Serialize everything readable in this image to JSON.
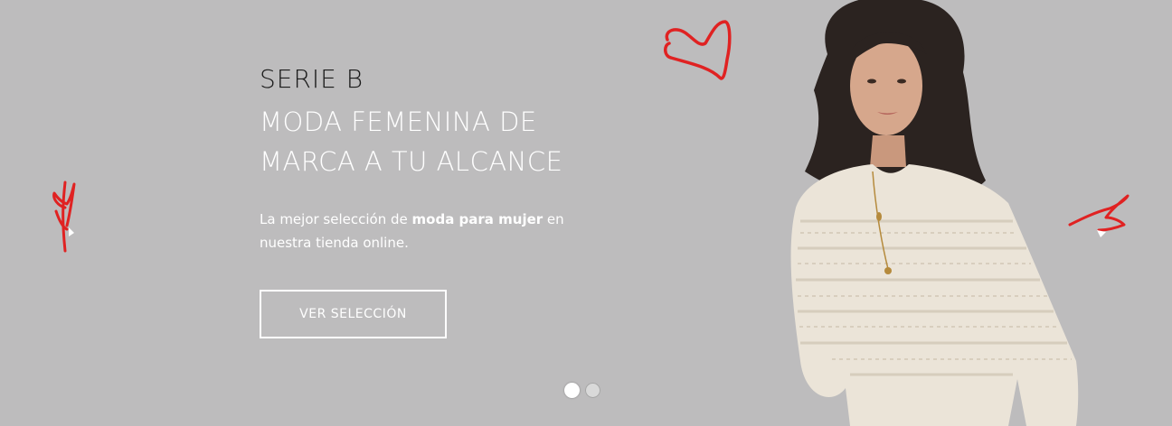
{
  "hero": {
    "brand": "SERIE B",
    "headline_line1": "MODA FEMENINA DE",
    "headline_line2": "MARCA A TU ALCANCE",
    "description_prefix": "La mejor selección de ",
    "description_bold": "moda para mujer",
    "description_suffix": " en nuestra tienda online.",
    "cta_label": "VER SELECCIÓN",
    "background_color": "#bdbcbd",
    "accent_color": "#e02222"
  },
  "carousel": {
    "slide_count": 2,
    "active_slide": 1,
    "prev_icon": "scribble-arrow-left-icon",
    "next_icon": "scribble-arrow-right-icon"
  },
  "decor": {
    "heart_icon": "heart-doodle-icon"
  }
}
